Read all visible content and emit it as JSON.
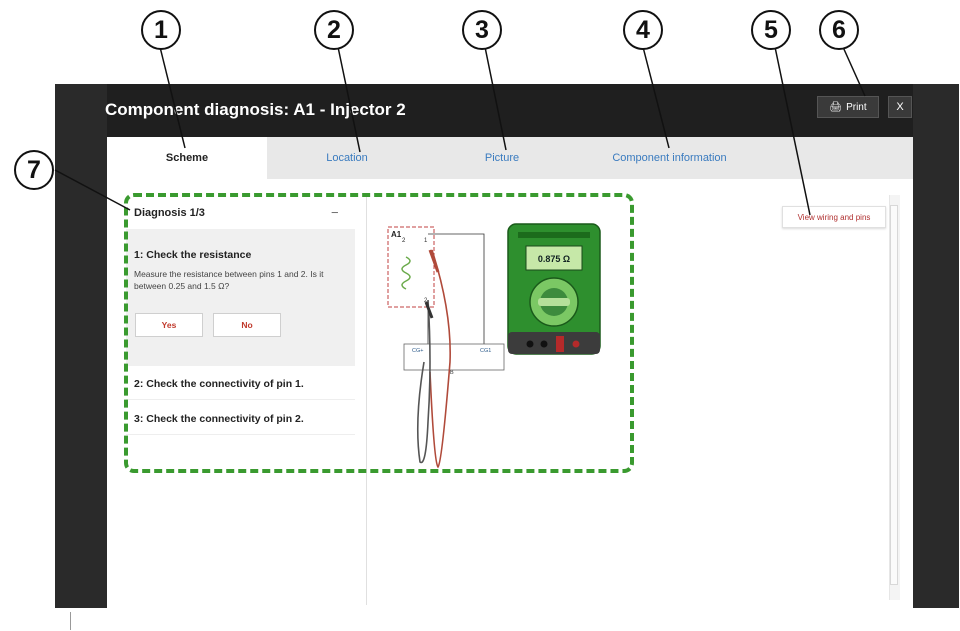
{
  "callouts": [
    "1",
    "2",
    "3",
    "4",
    "5",
    "6",
    "7"
  ],
  "window": {
    "title": "Component diagnosis: A1 - Injector 2",
    "print_label": "Print",
    "close_label": "X"
  },
  "tabs": [
    {
      "label": "Scheme",
      "active": true
    },
    {
      "label": "Location",
      "active": false
    },
    {
      "label": "Picture",
      "active": false
    },
    {
      "label": "Component information",
      "active": false
    },
    {
      "label": "",
      "active": false
    }
  ],
  "diagnosis": {
    "header": "Diagnosis 1/3",
    "collapse_symbol": "−",
    "step1": {
      "title": "1: Check the resistance",
      "text": "Measure the resistance between pins 1 and 2. Is it between 0.25 and 1.5 Ω?",
      "yes_label": "Yes",
      "no_label": "No"
    },
    "step2_title": "2: Check the connectivity of pin 1.",
    "step3_title": "3: Check the connectivity of pin 2."
  },
  "view_wiring_label": "View wiring and pins",
  "scheme": {
    "component_label": "A1",
    "component_sub": "2",
    "pin1": "1",
    "pin2": "2",
    "connector_left": "CG+",
    "connector_right": "CG1",
    "connector_bottom": "B",
    "multimeter_reading": "0.875 Ω"
  },
  "colors": {
    "highlight_dash": "#3a9a2f",
    "tab_link": "#3a7bbf",
    "button_text": "#c0392b",
    "multimeter_body": "#2e8f2e",
    "display": "#c6e8a8"
  }
}
